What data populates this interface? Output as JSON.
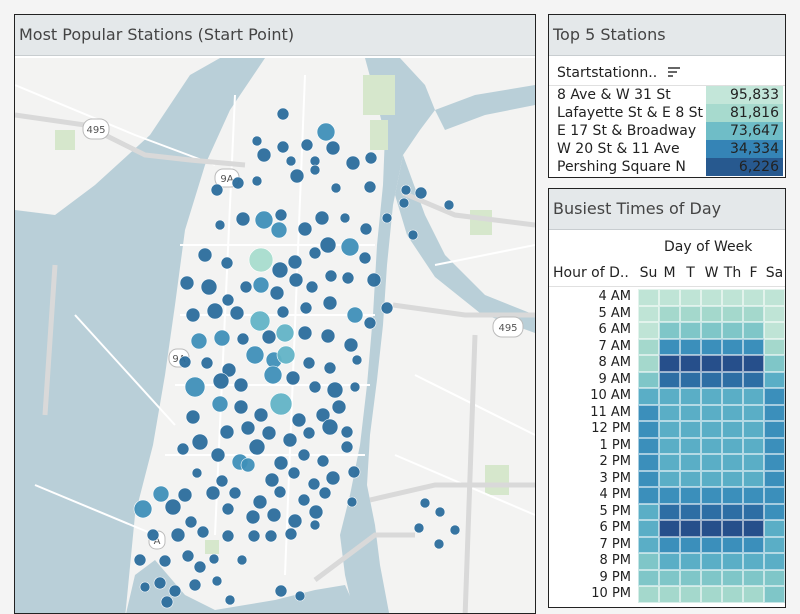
{
  "colors": {
    "water": "#b9cfd8",
    "land": "#f3f3f2",
    "park": "#d6e7cc",
    "road": "#ffffff",
    "highway": "#dcdcdc",
    "dot_small": "#2b6d9c",
    "dot_large": "#a8dccd"
  },
  "map": {
    "title": "Most Popular Stations (Start Point)",
    "labels": {
      "i495_left": "495",
      "ny9a": "9A",
      "i495_right": "495",
      "ny9a_lower": "9A",
      "edge_9": "9",
      "edge_a": "A"
    },
    "stations": [
      [
        268,
        99,
        6,
        1
      ],
      [
        311,
        117,
        9,
        2
      ],
      [
        242,
        126,
        5,
        1
      ],
      [
        268,
        132,
        6,
        1
      ],
      [
        292,
        130,
        6,
        1
      ],
      [
        318,
        133,
        7,
        1
      ],
      [
        249,
        140,
        7,
        1
      ],
      [
        276,
        146,
        5,
        1
      ],
      [
        300,
        146,
        5,
        1
      ],
      [
        338,
        148,
        7,
        1
      ],
      [
        356,
        143,
        6,
        1
      ],
      [
        202,
        175,
        6,
        1
      ],
      [
        223,
        168,
        6,
        1
      ],
      [
        242,
        166,
        5,
        1
      ],
      [
        282,
        161,
        7,
        1
      ],
      [
        300,
        155,
        5,
        1
      ],
      [
        321,
        173,
        5,
        1
      ],
      [
        355,
        172,
        6,
        1
      ],
      [
        391,
        175,
        5,
        1
      ],
      [
        406,
        178,
        6,
        1
      ],
      [
        434,
        190,
        5,
        1
      ],
      [
        205,
        210,
        5,
        1
      ],
      [
        228,
        204,
        7,
        1
      ],
      [
        249,
        205,
        9,
        2
      ],
      [
        266,
        200,
        6,
        1
      ],
      [
        264,
        215,
        8,
        2
      ],
      [
        290,
        214,
        7,
        1
      ],
      [
        307,
        203,
        7,
        1
      ],
      [
        330,
        203,
        5,
        1
      ],
      [
        351,
        214,
        6,
        1
      ],
      [
        372,
        203,
        5,
        1
      ],
      [
        389,
        188,
        5,
        1
      ],
      [
        398,
        220,
        5,
        1
      ],
      [
        190,
        240,
        7,
        1
      ],
      [
        212,
        248,
        6,
        1
      ],
      [
        246,
        245,
        12,
        4
      ],
      [
        265,
        255,
        8,
        1
      ],
      [
        280,
        247,
        7,
        1
      ],
      [
        300,
        238,
        6,
        1
      ],
      [
        313,
        230,
        8,
        1
      ],
      [
        335,
        232,
        9,
        2
      ],
      [
        350,
        243,
        6,
        1
      ],
      [
        359,
        265,
        7,
        1
      ],
      [
        372,
        293,
        6,
        1
      ],
      [
        172,
        268,
        7,
        1
      ],
      [
        194,
        272,
        8,
        1
      ],
      [
        213,
        285,
        6,
        1
      ],
      [
        231,
        272,
        6,
        1
      ],
      [
        246,
        270,
        8,
        2
      ],
      [
        262,
        278,
        7,
        1
      ],
      [
        281,
        265,
        7,
        1
      ],
      [
        297,
        272,
        6,
        1
      ],
      [
        316,
        261,
        6,
        1
      ],
      [
        333,
        263,
        6,
        1
      ],
      [
        178,
        300,
        7,
        1
      ],
      [
        200,
        296,
        8,
        1
      ],
      [
        222,
        298,
        7,
        1
      ],
      [
        245,
        306,
        10,
        3
      ],
      [
        268,
        297,
        6,
        1
      ],
      [
        291,
        293,
        6,
        1
      ],
      [
        315,
        288,
        7,
        1
      ],
      [
        340,
        300,
        8,
        2
      ],
      [
        355,
        308,
        6,
        1
      ],
      [
        184,
        326,
        8,
        2
      ],
      [
        207,
        323,
        8,
        2
      ],
      [
        228,
        324,
        6,
        1
      ],
      [
        254,
        322,
        7,
        1
      ],
      [
        270,
        318,
        9,
        3
      ],
      [
        290,
        318,
        7,
        1
      ],
      [
        313,
        321,
        7,
        1
      ],
      [
        336,
        330,
        7,
        1
      ],
      [
        170,
        347,
        6,
        1
      ],
      [
        192,
        348,
        6,
        1
      ],
      [
        214,
        355,
        7,
        1
      ],
      [
        240,
        340,
        9,
        2
      ],
      [
        259,
        345,
        8,
        2
      ],
      [
        271,
        340,
        9,
        3
      ],
      [
        294,
        348,
        6,
        1
      ],
      [
        315,
        353,
        6,
        1
      ],
      [
        342,
        345,
        5,
        1
      ],
      [
        180,
        372,
        10,
        2
      ],
      [
        206,
        366,
        8,
        1
      ],
      [
        226,
        370,
        7,
        1
      ],
      [
        258,
        360,
        9,
        2
      ],
      [
        278,
        363,
        7,
        1
      ],
      [
        300,
        372,
        6,
        1
      ],
      [
        320,
        375,
        8,
        1
      ],
      [
        340,
        372,
        5,
        1
      ],
      [
        178,
        402,
        7,
        1
      ],
      [
        205,
        389,
        8,
        2
      ],
      [
        226,
        392,
        7,
        1
      ],
      [
        246,
        400,
        7,
        1
      ],
      [
        266,
        389,
        11,
        3
      ],
      [
        284,
        405,
        7,
        1
      ],
      [
        308,
        400,
        7,
        1
      ],
      [
        324,
        392,
        7,
        1
      ],
      [
        185,
        427,
        8,
        1
      ],
      [
        212,
        417,
        7,
        1
      ],
      [
        233,
        413,
        7,
        1
      ],
      [
        254,
        418,
        7,
        1
      ],
      [
        275,
        425,
        7,
        1
      ],
      [
        294,
        418,
        6,
        1
      ],
      [
        315,
        412,
        8,
        1
      ],
      [
        332,
        417,
        6,
        1
      ],
      [
        168,
        434,
        6,
        1
      ],
      [
        203,
        440,
        7,
        1
      ],
      [
        225,
        447,
        8,
        2
      ],
      [
        242,
        432,
        8,
        1
      ],
      [
        266,
        448,
        7,
        1
      ],
      [
        289,
        440,
        6,
        1
      ],
      [
        308,
        446,
        6,
        1
      ],
      [
        332,
        432,
        6,
        1
      ],
      [
        182,
        458,
        5,
        1
      ],
      [
        207,
        466,
        6,
        1
      ],
      [
        233,
        450,
        7,
        2
      ],
      [
        257,
        465,
        7,
        1
      ],
      [
        279,
        458,
        6,
        1
      ],
      [
        299,
        469,
        6,
        1
      ],
      [
        318,
        463,
        7,
        1
      ],
      [
        339,
        457,
        6,
        1
      ],
      [
        146,
        479,
        8,
        2
      ],
      [
        170,
        480,
        7,
        1
      ],
      [
        198,
        478,
        7,
        1
      ],
      [
        220,
        478,
        6,
        1
      ],
      [
        245,
        487,
        7,
        1
      ],
      [
        265,
        477,
        6,
        1
      ],
      [
        289,
        485,
        6,
        1
      ],
      [
        310,
        478,
        6,
        1
      ],
      [
        128,
        494,
        9,
        2
      ],
      [
        158,
        492,
        8,
        1
      ],
      [
        176,
        507,
        6,
        1
      ],
      [
        213,
        494,
        6,
        1
      ],
      [
        238,
        502,
        7,
        1
      ],
      [
        259,
        500,
        7,
        1
      ],
      [
        280,
        506,
        7,
        1
      ],
      [
        301,
        497,
        7,
        1
      ],
      [
        337,
        487,
        5,
        1
      ],
      [
        138,
        520,
        6,
        1
      ],
      [
        163,
        520,
        7,
        1
      ],
      [
        188,
        517,
        6,
        1
      ],
      [
        213,
        521,
        6,
        1
      ],
      [
        239,
        521,
        6,
        1
      ],
      [
        256,
        521,
        6,
        1
      ],
      [
        276,
        519,
        6,
        1
      ],
      [
        300,
        510,
        5,
        1
      ],
      [
        410,
        488,
        5,
        1
      ],
      [
        425,
        497,
        5,
        1
      ],
      [
        125,
        545,
        6,
        1
      ],
      [
        150,
        546,
        6,
        1
      ],
      [
        173,
        541,
        6,
        1
      ],
      [
        185,
        552,
        6,
        1
      ],
      [
        199,
        544,
        5,
        1
      ],
      [
        227,
        545,
        5,
        1
      ],
      [
        404,
        513,
        5,
        1
      ],
      [
        424,
        529,
        5,
        1
      ],
      [
        440,
        515,
        5,
        1
      ],
      [
        145,
        568,
        6,
        1
      ],
      [
        160,
        576,
        6,
        1
      ],
      [
        180,
        570,
        6,
        1
      ],
      [
        202,
        566,
        5,
        1
      ],
      [
        266,
        576,
        6,
        1
      ],
      [
        285,
        581,
        5,
        1
      ],
      [
        130,
        572,
        5,
        1
      ],
      [
        152,
        587,
        6,
        1
      ],
      [
        215,
        585,
        5,
        1
      ]
    ]
  },
  "top5": {
    "title": "Top 5 Stations",
    "column_header": "Startstationn..",
    "sort_icon": "sort-descending-icon",
    "rows": [
      {
        "name": "8 Ave & W 31 St",
        "value": "95,833",
        "color": "#c3e6d9"
      },
      {
        "name": "Lafayette St & E 8 St",
        "value": "81,816",
        "color": "#a7dace"
      },
      {
        "name": "E 17 St & Broadway",
        "value": "73,647",
        "color": "#6fbdc7"
      },
      {
        "name": "W 20 St & 11 Ave",
        "value": "34,334",
        "color": "#3584b6"
      },
      {
        "name": "Pershing Square N",
        "value": "6,226",
        "color": "#27598f"
      }
    ]
  },
  "busiest": {
    "title": "Busiest Times of Day",
    "col_header": "Day of Week",
    "row_header": "Hour of D..",
    "days": [
      "Su",
      "M",
      "T",
      "W",
      "Th",
      "F",
      "Sa"
    ],
    "hours": [
      "4 AM",
      "5 AM",
      "6 AM",
      "7 AM",
      "8 AM",
      "9 AM",
      "10 AM",
      "11 AM",
      "12 PM",
      "1 PM",
      "2 PM",
      "3 PM",
      "4 PM",
      "5 PM",
      "6 PM",
      "7 PM",
      "8 PM",
      "9 PM",
      "10 PM"
    ],
    "levels": [
      [
        0,
        0,
        0,
        0,
        0,
        0,
        0
      ],
      [
        0,
        1,
        1,
        1,
        1,
        1,
        0
      ],
      [
        0,
        2,
        2,
        2,
        2,
        2,
        0
      ],
      [
        1,
        4,
        4,
        4,
        4,
        4,
        1
      ],
      [
        1,
        6,
        6,
        6,
        6,
        6,
        2
      ],
      [
        2,
        5,
        5,
        5,
        5,
        5,
        3
      ],
      [
        3,
        3,
        3,
        3,
        3,
        3,
        4
      ],
      [
        4,
        3,
        3,
        3,
        3,
        3,
        4
      ],
      [
        4,
        3,
        3,
        3,
        3,
        3,
        4
      ],
      [
        4,
        3,
        3,
        3,
        3,
        3,
        4
      ],
      [
        4,
        3,
        3,
        3,
        3,
        3,
        4
      ],
      [
        4,
        3,
        3,
        3,
        3,
        3,
        4
      ],
      [
        4,
        4,
        4,
        4,
        4,
        4,
        4
      ],
      [
        3,
        5,
        5,
        5,
        5,
        5,
        4
      ],
      [
        3,
        6,
        6,
        6,
        6,
        6,
        3
      ],
      [
        3,
        4,
        4,
        4,
        4,
        4,
        3
      ],
      [
        2,
        3,
        3,
        3,
        3,
        3,
        3
      ],
      [
        2,
        2,
        2,
        2,
        2,
        2,
        2
      ],
      [
        1,
        1,
        1,
        1,
        1,
        1,
        2
      ]
    ],
    "palette": [
      "#bfe4d6",
      "#a4d8cc",
      "#7fc6c8",
      "#5aaec6",
      "#3b8fbb",
      "#2d6ea4",
      "#264f8b"
    ]
  }
}
